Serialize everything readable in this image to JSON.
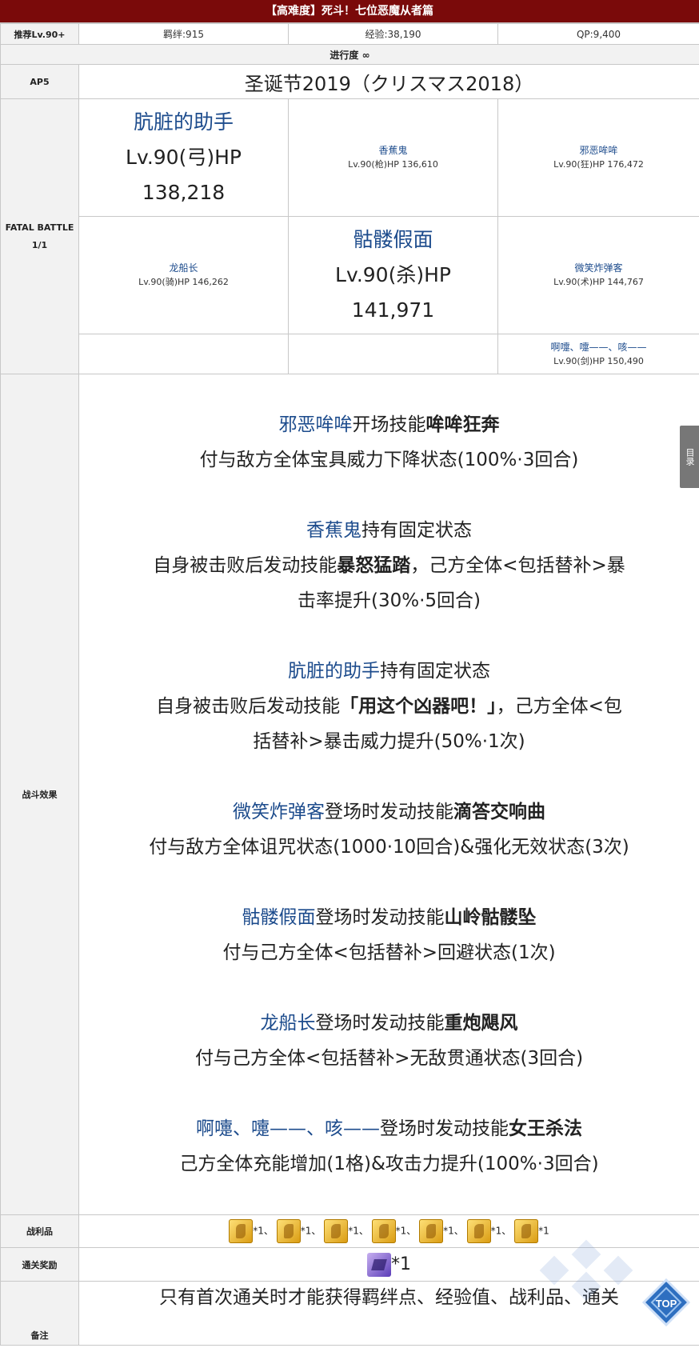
{
  "title": "【高难度】死斗！七位恶魔从者篇",
  "info": {
    "recommend": "推荐Lv.90+",
    "bond": "羁绊:915",
    "exp": "经验:38,190",
    "qp": "QP:9,400"
  },
  "progress": "进行度 ∞",
  "ap_label": "AP5",
  "event_name": "圣诞节2019（クリスマス2018）",
  "battle_label": "FATAL BATTLE\n1/1",
  "enemies": {
    "e1": {
      "name": "肮脏的助手",
      "line1": "Lv.90(弓)HP",
      "line2": "138,218"
    },
    "e2": {
      "name": "香蕉鬼",
      "line1": "Lv.90(枪)HP 136,610"
    },
    "e3": {
      "name": "邪恶哞哞",
      "line1": "Lv.90(狂)HP 176,472"
    },
    "e4": {
      "name": "龙船长",
      "line1": "Lv.90(骑)HP 146,262"
    },
    "e5": {
      "name": "骷髅假面",
      "line1": "Lv.90(杀)HP",
      "line2": "141,971"
    },
    "e6": {
      "name": "微笑炸弹客",
      "line1": "Lv.90(术)HP 144,767"
    },
    "e7": {
      "name": "啊嚏、嚏——、咳——",
      "line1": "Lv.90(剑)HP 150,490"
    }
  },
  "effects_label": "战斗效果",
  "effects": {
    "b1": {
      "name": "邪恶哞哞",
      "mid": "开场技能",
      "skill": "哞哞狂奔",
      "desc": "付与敌方全体宝具威力下降状态(100%·3回合)"
    },
    "b2": {
      "name": "香蕉鬼",
      "mid": "持有固定状态",
      "desc_pre": "自身被击败后发动技能",
      "skill": "暴怒猛踏",
      "desc_post": "，己方全体<包括替补>暴",
      "desc2": "击率提升(30%·5回合)"
    },
    "b3": {
      "name": "肮脏的助手",
      "mid": "持有固定状态",
      "desc_pre": "自身被击败后发动技能",
      "skill": "「用这个凶器吧！」",
      "desc_post": "，己方全体<包",
      "desc2": "括替补>暴击威力提升(50%·1次)"
    },
    "b4": {
      "name": "微笑炸弹客",
      "mid": "登场时发动技能",
      "skill": "滴答交响曲",
      "desc": "付与敌方全体诅咒状态(1000·10回合)&强化无效状态(3次)"
    },
    "b5": {
      "name": "骷髅假面",
      "mid": "登场时发动技能",
      "skill": "山岭骷髅坠",
      "desc": "付与己方全体<包括替补>回避状态(1次)"
    },
    "b6": {
      "name": "龙船长",
      "mid": "登场时发动技能",
      "skill": "重炮飓风",
      "desc": "付与己方全体<包括替补>无敌贯通状态(3回合)"
    },
    "b7": {
      "name": "啊嚏、嚏——、咳——",
      "mid": "登场时发动技能",
      "skill": "女王杀法",
      "desc": "己方全体充能增加(1格)&攻击力提升(100%·3回合)"
    }
  },
  "loot_label": "战利品",
  "loot": [
    "*1、",
    "*1、",
    "*1、",
    "*1、",
    "*1、",
    "*1、",
    "*1"
  ],
  "clear_label": "通关奖励",
  "clear_reward": "*1",
  "note_label": "备注",
  "note_text": "只有首次通关时才能获得羁绊点、经验值、战利品、通关",
  "side_tab": "目录",
  "top_button": "TOP",
  "colors": {
    "title_bg": "#7a0a0a",
    "link_blue": "#1c4b8c",
    "label_bg": "#f2f2f2",
    "border": "#c8c8c8"
  }
}
